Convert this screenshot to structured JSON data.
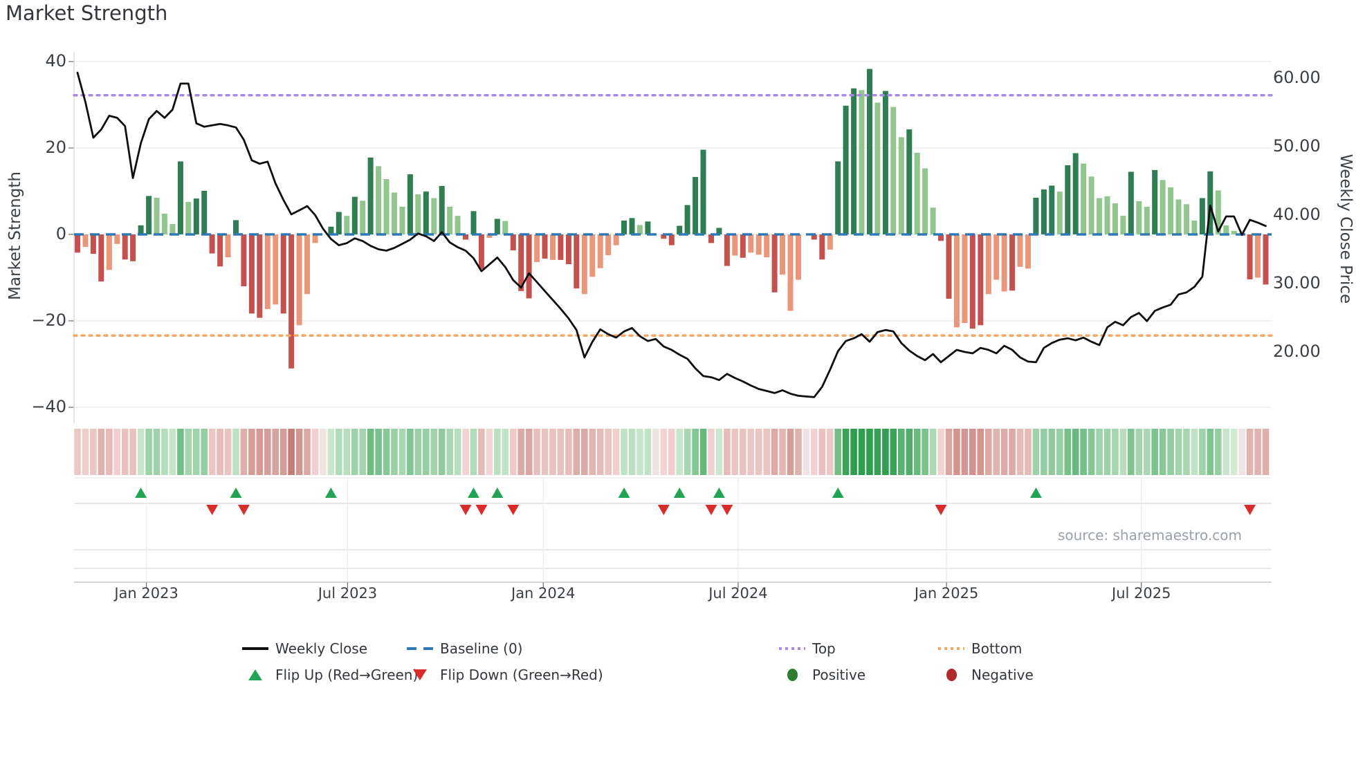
{
  "title": "Market Strength",
  "source_text": "source: sharemaestro.com",
  "axes": {
    "left": {
      "label": "Market Strength",
      "ticks": [
        {
          "v": 40,
          "label": "40"
        },
        {
          "v": 20,
          "label": "20"
        },
        {
          "v": 0,
          "label": "0"
        },
        {
          "v": -20,
          "label": "−20"
        },
        {
          "v": -40,
          "label": "−40"
        }
      ]
    },
    "right": {
      "label": "Weekly Close Price",
      "ticks": [
        {
          "v": 60,
          "label": "60.00"
        },
        {
          "v": 50,
          "label": "50.00"
        },
        {
          "v": 40,
          "label": "40.00"
        },
        {
          "v": 30,
          "label": "30.00"
        },
        {
          "v": 20,
          "label": "20.00"
        }
      ]
    },
    "x": {
      "ticks": [
        {
          "week": 8.7,
          "label": "Jan 2023"
        },
        {
          "week": 34.1,
          "label": "Jul 2023"
        },
        {
          "week": 58.8,
          "label": "Jan 2024"
        },
        {
          "week": 83.4,
          "label": "Jul 2024"
        },
        {
          "week": 109.7,
          "label": "Jan 2025"
        },
        {
          "week": 134.3,
          "label": "Jul 2025"
        }
      ]
    }
  },
  "legend": {
    "weekly_close": "Weekly Close",
    "baseline": "Baseline (0)",
    "top": "Top",
    "bottom": "Bottom",
    "flip_up": "Flip Up (Red→Green)",
    "flip_down": "Flip Down (Green→Red)",
    "positive": "Positive",
    "negative": "Negative"
  },
  "colors": {
    "bar_positive_dark": "#2f7d52",
    "bar_positive_light": "#92c68e",
    "bar_negative_dark": "#c5514e",
    "bar_negative_light": "#e9967a",
    "baseline_line": "#2e79b5",
    "top_line": "#a98ae3",
    "bottom_line": "#f5a661",
    "price_line": "#0f0f12",
    "flip_up_marker": "#23a455",
    "flip_down_marker": "#d92b2b",
    "positive_dot": "#2e7d32",
    "negative_dot": "#b02a28",
    "heat_pos_max": "#2f9e4f",
    "heat_pos_min": "#daeeda",
    "heat_neg_max": "#c47973",
    "heat_neg_min": "#f5dbd9",
    "heat_zero": "#f0e4e2",
    "grid": "#ebebf2"
  },
  "chart_data": {
    "type": "bar",
    "subtype": "weekly market-strength bars (left axis) + weekly close price line (right axis) + derived weekly heatmap strip + flip markers",
    "x_unit": "weeks, Nov 2022 – Oct 2025",
    "title": "Market Strength",
    "left_ylim": [
      -40,
      40
    ],
    "right_ylim": [
      13,
      63
    ],
    "baseline": 0,
    "top_line": 32.2,
    "bottom_line": -23.4,
    "flip_up_weeks": [
      8,
      20,
      32,
      50,
      53,
      69,
      76,
      81,
      96,
      121
    ],
    "flip_down_weeks": [
      17,
      21,
      49,
      51,
      55,
      74,
      80,
      82,
      109,
      148
    ],
    "series": [
      {
        "name": "Market Strength",
        "type": "bar",
        "axis": "left",
        "values": [
          -4.2,
          -2.9,
          -4.5,
          -10.9,
          -8.2,
          -2.2,
          -5.8,
          -6.2,
          2.1,
          8.9,
          8.5,
          4.8,
          2.4,
          16.9,
          7.5,
          8.3,
          10.1,
          -4.4,
          -7.4,
          -5.3,
          3.3,
          -12.0,
          -18.3,
          -19.3,
          -17.3,
          -16.2,
          -18.3,
          -31.0,
          -21.0,
          -13.8,
          -2.0,
          0,
          1.8,
          5.2,
          4.3,
          8.7,
          7.8,
          17.8,
          15.8,
          12.8,
          9.7,
          6.4,
          13.9,
          9.3,
          9.9,
          8.4,
          11.2,
          6.4,
          4.3,
          -1.2,
          5.4,
          -8.0,
          -0.8,
          3.6,
          3.1,
          -3.7,
          -13.1,
          -14.8,
          -6.4,
          -5.6,
          -5.9,
          -5.9,
          -6.9,
          -12.5,
          -13.8,
          -9.8,
          -7.8,
          -4.8,
          -2.5,
          3.2,
          3.8,
          2.2,
          3.0,
          0,
          -1.0,
          -2.5,
          2.0,
          6.8,
          13.3,
          19.6,
          -2.0,
          1.5,
          -7.3,
          -4.9,
          -5.4,
          -4.2,
          -4.7,
          -5.3,
          -13.4,
          -9.3,
          -17.7,
          -10.5,
          0,
          -1.2,
          -5.8,
          -3.5,
          16.9,
          29.8,
          33.8,
          33.4,
          38.3,
          30.5,
          33.2,
          29.5,
          22.5,
          24.3,
          18.9,
          15.3,
          6.2,
          -1.5,
          -14.9,
          -21.5,
          -20.5,
          -21.8,
          -21.0,
          -13.8,
          -10.5,
          -13.2,
          -13.0,
          -7.5,
          -7.9,
          8.5,
          10.4,
          11.3,
          9.9,
          16.0,
          18.8,
          16.4,
          13.4,
          8.4,
          8.8,
          7.2,
          4.3,
          14.5,
          7.7,
          6.4,
          14.9,
          12.6,
          10.9,
          8.1,
          7.0,
          3.2,
          8.4,
          14.6,
          10.2,
          2.1,
          0.8,
          0,
          -10.4,
          -10.0,
          -11.6
        ],
        "bar_shades": [
          "dr",
          "lr",
          "dr",
          "dr",
          "lr",
          "lr",
          "dr",
          "dr",
          "dg",
          "dg",
          "lg",
          "lg",
          "lg",
          "dg",
          "lg",
          "dg",
          "dg",
          "dr",
          "dr",
          "lr",
          "dg",
          "dr",
          "dr",
          "dr",
          "lr",
          "lr",
          "dr",
          "dr",
          "lr",
          "lr",
          "lr",
          null,
          "dg",
          "dg",
          "lg",
          "dg",
          "lg",
          "dg",
          "lg",
          "lg",
          "lg",
          "lg",
          "dg",
          "lg",
          "dg",
          "lg",
          "dg",
          "lg",
          "lg",
          "dr",
          "dg",
          "dr",
          "lr",
          "dg",
          "lg",
          "dr",
          "dr",
          "dr",
          "lr",
          "dr",
          "lr",
          "dr",
          "dr",
          "dr",
          "lr",
          "lr",
          "lr",
          "lr",
          "lr",
          "dg",
          "dg",
          "lg",
          "dg",
          null,
          "dr",
          "dr",
          "dg",
          "dg",
          "dg",
          "dg",
          "dr",
          "dg",
          "dr",
          "lr",
          "dr",
          "lr",
          "lr",
          "lr",
          "dr",
          "lr",
          "lr",
          "lr",
          null,
          "dr",
          "dr",
          "lr",
          "dg",
          "dg",
          "dg",
          "lg",
          "dg",
          "lg",
          "dg",
          "lg",
          "lg",
          "dg",
          "lg",
          "lg",
          "lg",
          "dr",
          "dr",
          "lr",
          "lr",
          "dr",
          "dr",
          "lr",
          "lr",
          "lr",
          "dr",
          "lr",
          "lr",
          "dg",
          "dg",
          "dg",
          "lg",
          "dg",
          "dg",
          "lg",
          "lg",
          "lg",
          "lg",
          "lg",
          "lg",
          "dg",
          "lg",
          "lg",
          "dg",
          "lg",
          "lg",
          "lg",
          "lg",
          "lg",
          "dg",
          "dg",
          "lg",
          "lg",
          "lg",
          null,
          "dr",
          "lr",
          "dr"
        ]
      },
      {
        "name": "Weekly Close",
        "type": "line",
        "axis": "right",
        "values": [
          60.8,
          56.5,
          51.3,
          52.5,
          54.5,
          54.2,
          53.0,
          45.4,
          50.5,
          54.0,
          55.2,
          54.2,
          55.4,
          59.2,
          59.2,
          53.4,
          52.9,
          53.1,
          53.3,
          53.1,
          52.8,
          51.0,
          48.0,
          47.5,
          47.8,
          44.6,
          42.2,
          40.1,
          40.7,
          41.3,
          40.0,
          38.0,
          36.5,
          35.6,
          35.9,
          36.6,
          36.2,
          35.5,
          35.0,
          34.8,
          35.2,
          35.8,
          36.4,
          37.3,
          36.9,
          36.2,
          37.5,
          36.0,
          35.3,
          34.8,
          33.7,
          31.8,
          32.8,
          33.8,
          32.4,
          30.5,
          29.4,
          31.5,
          30.2,
          28.9,
          27.6,
          26.3,
          24.9,
          23.2,
          19.2,
          21.5,
          23.3,
          22.6,
          22.1,
          23.0,
          23.5,
          22.3,
          21.6,
          21.9,
          20.8,
          20.3,
          19.6,
          19.0,
          17.6,
          16.5,
          16.3,
          15.9,
          16.8,
          16.2,
          15.7,
          15.1,
          14.6,
          14.3,
          14.0,
          14.4,
          13.9,
          13.6,
          13.5,
          13.4,
          14.9,
          17.4,
          20.1,
          21.6,
          22.0,
          22.6,
          21.5,
          22.9,
          23.2,
          23.0,
          21.3,
          20.2,
          19.4,
          18.8,
          19.7,
          18.5,
          19.4,
          20.3,
          20.0,
          19.8,
          20.6,
          20.3,
          19.8,
          20.9,
          20.3,
          19.2,
          18.6,
          18.5,
          20.6,
          21.3,
          21.8,
          22.0,
          21.7,
          22.1,
          21.5,
          21.0,
          23.6,
          24.4,
          23.9,
          25.1,
          25.7,
          24.5,
          26.0,
          26.5,
          26.9,
          28.4,
          28.7,
          29.5,
          31.0,
          41.4,
          37.6,
          39.8,
          39.8,
          37.1,
          39.3,
          38.9,
          38.4
        ]
      }
    ]
  }
}
